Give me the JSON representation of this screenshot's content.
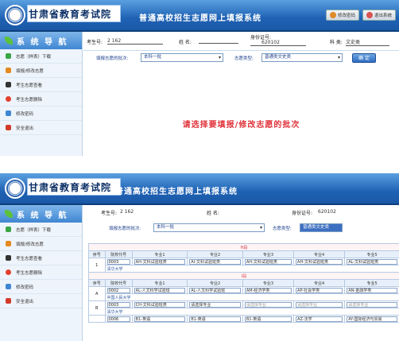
{
  "banner": {
    "logo_text": "甘肃省教育考试院",
    "system_title": "普通高校招生志愿网上填报系统",
    "links": [
      {
        "label": "修改密码",
        "icon": "key-icon"
      },
      {
        "label": "退出系统",
        "icon": "exit-icon"
      }
    ]
  },
  "sidebar": {
    "title": "系 统 导 航",
    "items": [
      {
        "label": "志愿（样表）下载",
        "icon": "download-icon",
        "color": "#3aa545"
      },
      {
        "label": "填报/修改志愿",
        "icon": "edit-icon",
        "color": "#e58a1f"
      },
      {
        "label": "考生志愿查看",
        "icon": "binoculars-icon",
        "color": "#333333"
      },
      {
        "label": "考生志愿删除",
        "icon": "delete-icon",
        "color": "#e0402e"
      },
      {
        "label": "修改密码",
        "icon": "lock-icon",
        "color": "#3f86d2"
      },
      {
        "label": "安全退出",
        "icon": "logout-icon",
        "color": "#d23a2a"
      }
    ]
  },
  "screen1": {
    "exam_no_label": "考生号:",
    "exam_no_value": "2 162",
    "name_label": "姓 名:",
    "name_value": "",
    "id_label": "身份证号:",
    "id_value": "620102",
    "subject_label": "科 类:",
    "subject_value": "文史类",
    "batch_label": "填报志愿的批次:",
    "batch_value": "本科一批",
    "subject_select_label": "志愿类型:",
    "subject_select_value": "普通类文史类",
    "confirm_button": "确 定",
    "prompt": "请选择要填报/修改志愿的批次"
  },
  "screen2": {
    "exam_no_label": "考生号:",
    "exam_no_value": "2 162",
    "name_label": "姓 名:",
    "id_label": "身份证号:",
    "id_value": "620102",
    "batch_label": "填报志愿的批次:",
    "batch_value": "本科一批",
    "type_label": "志愿类型:",
    "type_value": "普通类文史类",
    "headers": [
      "序号",
      "院校代号",
      "专业1",
      "专业2",
      "专业3",
      "专业4",
      "专业5"
    ],
    "segment_h": "H段",
    "segment_i": "I段",
    "h_rows": [
      {
        "no": "1",
        "code": "0003",
        "school": "清华大学",
        "majors": [
          "AH-文科试验班类",
          "AI-文科试验班类",
          "AH-文科试验班类",
          "AH-文科试验班类",
          "AL-文科试验班类"
        ]
      }
    ],
    "i_rows": [
      {
        "no": "A",
        "code": "0002",
        "school": "中国人民大学",
        "majors": [
          "AL-人文科学试验班",
          "AL-人文科学试验班",
          "AM-经济学类",
          "AP-社会学类",
          "AN-金融学类"
        ]
      },
      {
        "no": "B",
        "code": "0003",
        "school": "清华大学",
        "majors": [
          "CH-文科试验班类",
          "请选择专业",
          "请选择专业",
          "请选择专业",
          "请选择专业"
        ]
      },
      {
        "no": "",
        "code": "0006",
        "school": "",
        "majors": [
          "B1-英语",
          "B1-英语",
          "B1-英语",
          "AZ-法学",
          "AY-国际经济与贸易"
        ]
      }
    ]
  }
}
